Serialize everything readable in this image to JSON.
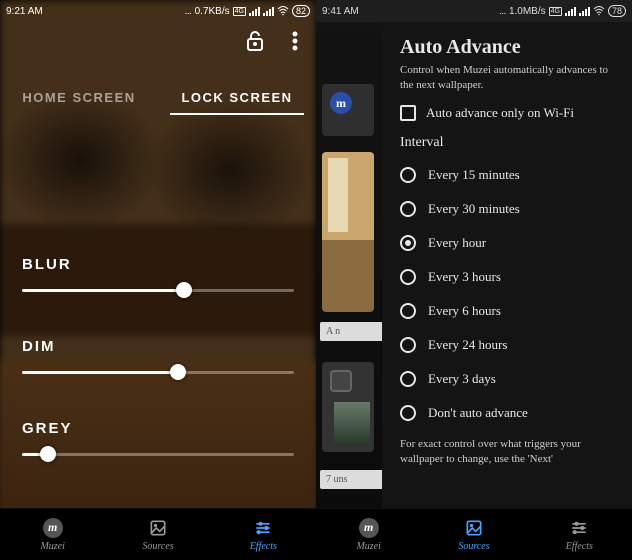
{
  "left": {
    "status": {
      "time": "9:21 AM",
      "net": "0.7KB/s",
      "net_label": "4G",
      "battery": "82"
    },
    "actions": {
      "unlock_icon": "unlock-icon",
      "more_icon": "more-vert-icon"
    },
    "tabs": {
      "home": "HOME SCREEN",
      "lock": "LOCK SCREEN",
      "active": "lock"
    },
    "sliders": {
      "blur": {
        "label": "BLUR",
        "value": 60
      },
      "dim": {
        "label": "DIM",
        "value": 58
      },
      "grey": {
        "label": "GREY",
        "value": 7
      }
    },
    "nav": {
      "muzei": "Muzei",
      "sources": "Sources",
      "effects": "Effects",
      "active": "effects"
    }
  },
  "right": {
    "status": {
      "time": "9:41 AM",
      "net": "1.0MB/s",
      "net_label": "4G",
      "battery": "78"
    },
    "panel": {
      "title": "Auto Advance",
      "subtitle": "Control when Muzei automatically advances to the next wallpaper.",
      "wifi_only": {
        "label": "Auto advance only on Wi-Fi",
        "checked": false
      },
      "section": "Interval",
      "options": [
        {
          "label": "Every 15 minutes",
          "selected": false
        },
        {
          "label": "Every 30 minutes",
          "selected": false
        },
        {
          "label": "Every hour",
          "selected": true
        },
        {
          "label": "Every 3 hours",
          "selected": false
        },
        {
          "label": "Every 6 hours",
          "selected": false
        },
        {
          "label": "Every 24 hours",
          "selected": false
        },
        {
          "label": "Every 3 days",
          "selected": false
        },
        {
          "label": "Don't auto advance",
          "selected": false
        }
      ],
      "note": "For exact control over what triggers your wallpaper to change, use the 'Next'"
    },
    "strip": {
      "caption_a": "A n",
      "caption_b": "7 uns"
    },
    "nav": {
      "muzei": "Muzei",
      "sources": "Sources",
      "effects": "Effects",
      "active": "sources"
    }
  }
}
